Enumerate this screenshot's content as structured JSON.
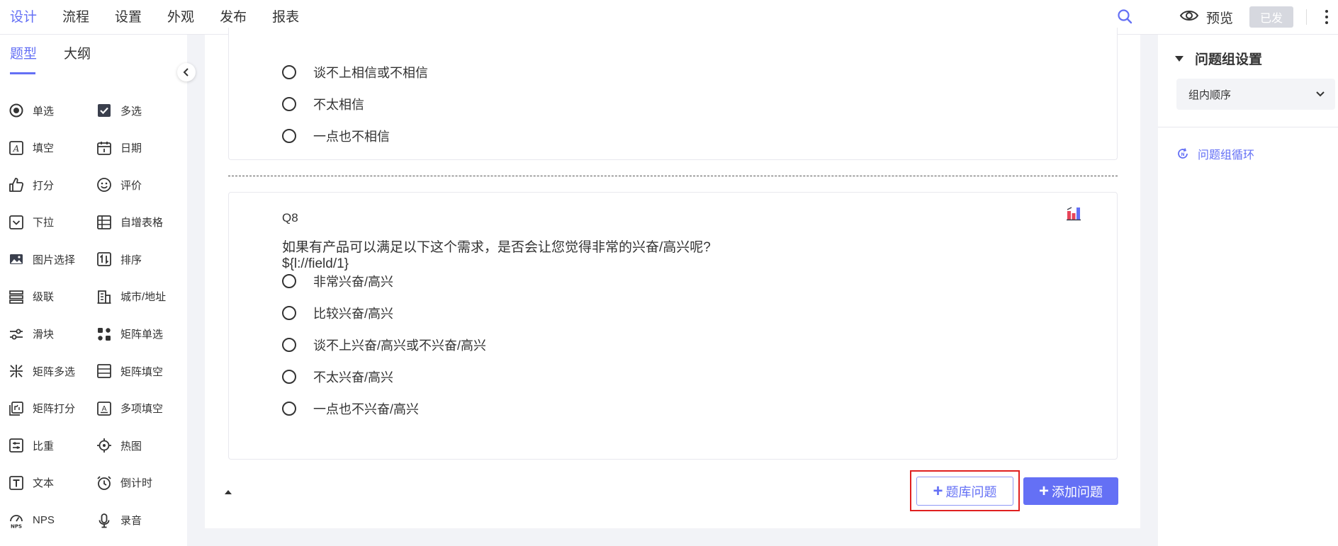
{
  "top_nav": {
    "items": [
      {
        "label": "设计",
        "active": true
      },
      {
        "label": "流程"
      },
      {
        "label": "设置"
      },
      {
        "label": "外观"
      },
      {
        "label": "发布"
      },
      {
        "label": "报表"
      }
    ],
    "preview_label": "预览",
    "publish_label": "已发"
  },
  "left_panel": {
    "tabs": [
      {
        "label": "题型",
        "active": true
      },
      {
        "label": "大纲"
      }
    ],
    "question_types": [
      {
        "label": "单选",
        "icon": "radio-icon"
      },
      {
        "label": "多选",
        "icon": "checkbox-icon"
      },
      {
        "label": "填空",
        "icon": "fill-blank-icon"
      },
      {
        "label": "日期",
        "icon": "calendar-icon"
      },
      {
        "label": "打分",
        "icon": "thumbs-up-icon"
      },
      {
        "label": "评价",
        "icon": "smiley-icon"
      },
      {
        "label": "下拉",
        "icon": "dropdown-icon"
      },
      {
        "label": "自增表格",
        "icon": "table-icon"
      },
      {
        "label": "图片选择",
        "icon": "image-icon"
      },
      {
        "label": "排序",
        "icon": "sort-icon"
      },
      {
        "label": "级联",
        "icon": "cascade-icon"
      },
      {
        "label": "城市/地址",
        "icon": "building-icon"
      },
      {
        "label": "滑块",
        "icon": "slider-icon"
      },
      {
        "label": "矩阵单选",
        "icon": "matrix-radio-icon"
      },
      {
        "label": "矩阵多选",
        "icon": "matrix-multi-icon"
      },
      {
        "label": "矩阵填空",
        "icon": "matrix-fill-icon"
      },
      {
        "label": "矩阵打分",
        "icon": "matrix-score-icon"
      },
      {
        "label": "多项填空",
        "icon": "multi-fill-icon"
      },
      {
        "label": "比重",
        "icon": "weight-icon"
      },
      {
        "label": "热图",
        "icon": "crosshair-icon"
      },
      {
        "label": "文本",
        "icon": "text-icon"
      },
      {
        "label": "倒计时",
        "icon": "alarm-clock-icon"
      },
      {
        "label": "NPS",
        "icon": "nps-gauge-icon"
      },
      {
        "label": "录音",
        "icon": "microphone-icon"
      }
    ]
  },
  "question_prev": {
    "options": [
      "谈不上相信或不相信",
      "不太相信",
      "一点也不相信"
    ]
  },
  "question_q8": {
    "number": "Q8",
    "title": "如果有产品可以满足以下这个需求，是否会让您觉得非常的兴奋/高兴呢?",
    "field_ref": "${l://field/1}",
    "options": [
      "非常兴奋/高兴",
      "比较兴奋/高兴",
      "谈不上兴奋/高兴或不兴奋/高兴",
      "不太兴奋/高兴",
      "一点也不兴奋/高兴"
    ]
  },
  "actions": {
    "bank_label": "题库问题",
    "add_label": "添加问题"
  },
  "right_panel": {
    "title": "问题组设置",
    "order_select": "组内顺序",
    "loop_label": "问题组循环"
  },
  "colors": {
    "accent": "#6470f5",
    "highlight": "#e02020"
  }
}
